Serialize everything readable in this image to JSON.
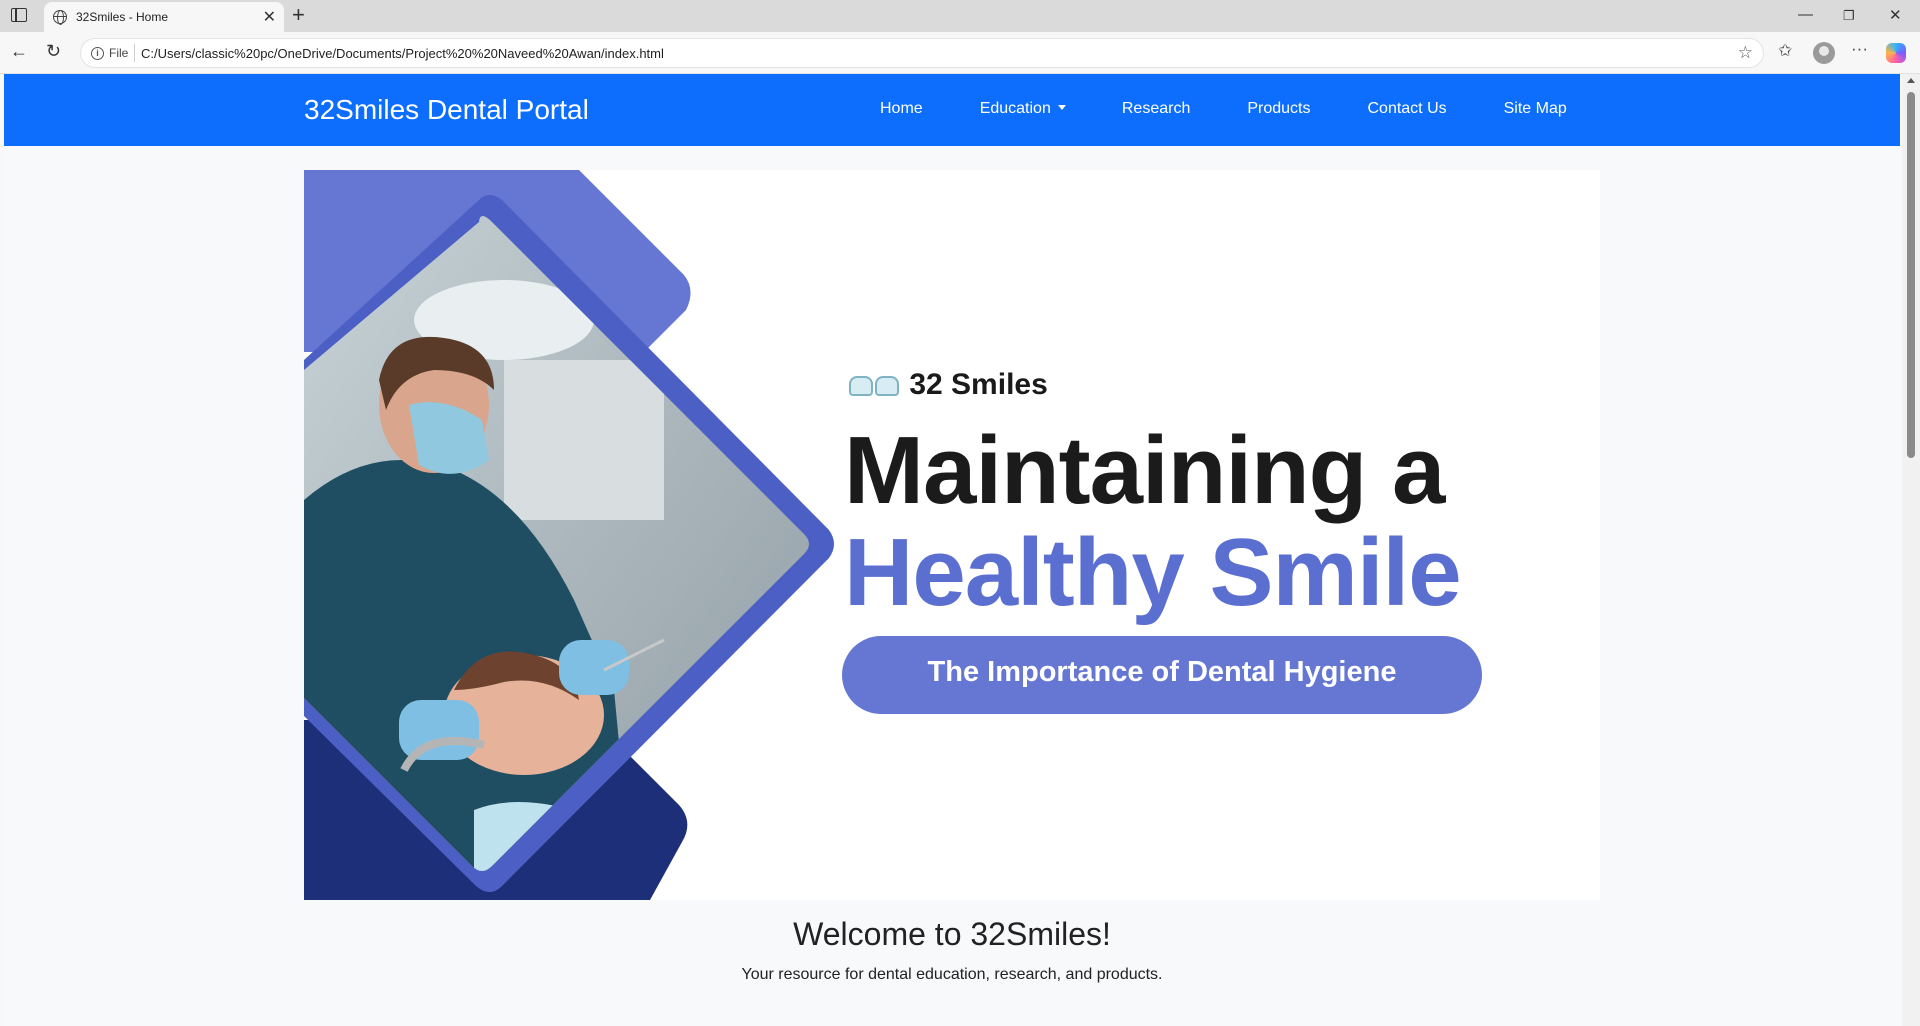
{
  "browser": {
    "tab_title": "32Smiles - Home",
    "file_label": "File",
    "url": "C:/Users/classic%20pc/OneDrive/Documents/Project%20%20Naveed%20Awan/index.html"
  },
  "site": {
    "brand": "32Smiles Dental Portal",
    "nav": [
      "Home",
      "Education",
      "Research",
      "Products",
      "Contact Us",
      "Site Map"
    ],
    "accent_color": "#0d6efd"
  },
  "hero": {
    "brand_line": "32 Smiles",
    "headline_line1": "Maintaining a",
    "headline_line2": "Healthy Smile",
    "pill_text": "The Importance of Dental Hygiene",
    "primary_color": "#5b6fd1",
    "dark_color": "#1e2f7a"
  },
  "welcome": {
    "title": "Welcome to 32Smiles!",
    "subtitle": "Your resource for dental education, research, and products."
  }
}
